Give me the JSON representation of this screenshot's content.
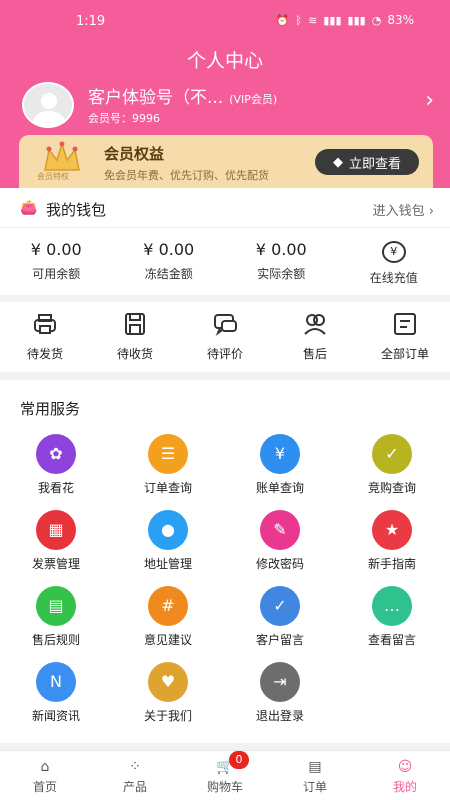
{
  "status_bar": {
    "time": "1:19",
    "icons": [
      "alarm-icon",
      "bluetooth-icon",
      "wifi-icon",
      "signal-icon",
      "signal-icon",
      "battery-icon"
    ],
    "battery": "83%"
  },
  "page_title": "个人中心",
  "profile": {
    "name": "客户体验号（不...",
    "vip_label": "(VIP会员)",
    "member_no": "会员号：9996"
  },
  "vip_card": {
    "badge_text": "会员特权",
    "title": "会员权益",
    "desc": "免会员年费、优先订购、优先配货",
    "button": "立即查看"
  },
  "wallet": {
    "title": "我的钱包",
    "link": "进入钱包",
    "items": [
      {
        "amount": "¥ 0.00",
        "label": "可用余额"
      },
      {
        "amount": "¥ 0.00",
        "label": "冻结金额"
      },
      {
        "amount": "¥ 0.00",
        "label": "实际余额"
      },
      {
        "icon": "¥",
        "label": "在线充值"
      }
    ]
  },
  "orders": [
    {
      "label": "待发货",
      "icon": "printer-icon"
    },
    {
      "label": "待收货",
      "icon": "save-icon"
    },
    {
      "label": "待评价",
      "icon": "chat-icon"
    },
    {
      "label": "售后",
      "icon": "people-icon"
    },
    {
      "label": "全部订单",
      "icon": "list-icon"
    }
  ],
  "services": {
    "title": "常用服务",
    "items": [
      {
        "label": "我看花",
        "color": "#8e44dc",
        "glyph": "✿"
      },
      {
        "label": "订单查询",
        "color": "#f3a01e",
        "glyph": "☰"
      },
      {
        "label": "账单查询",
        "color": "#2f8ff0",
        "glyph": "¥"
      },
      {
        "label": "竞购查询",
        "color": "#b7b321",
        "glyph": "✓"
      },
      {
        "label": "发票管理",
        "color": "#e8333b",
        "glyph": "▦"
      },
      {
        "label": "地址管理",
        "color": "#2aa0f5",
        "glyph": "●"
      },
      {
        "label": "修改密码",
        "color": "#e8388f",
        "glyph": "✎"
      },
      {
        "label": "新手指南",
        "color": "#ea3a43",
        "glyph": "★"
      },
      {
        "label": "售后规则",
        "color": "#35c24a",
        "glyph": "▤"
      },
      {
        "label": "意见建议",
        "color": "#f08a1f",
        "glyph": "#"
      },
      {
        "label": "客户留言",
        "color": "#3f87e0",
        "glyph": "✓"
      },
      {
        "label": "查看留言",
        "color": "#2fc28f",
        "glyph": "…"
      },
      {
        "label": "新闻资讯",
        "color": "#3b8ff0",
        "glyph": "N"
      },
      {
        "label": "关于我们",
        "color": "#dfa42f",
        "glyph": "♥"
      },
      {
        "label": "退出登录",
        "color": "#6d6d6d",
        "glyph": "⇥"
      }
    ]
  },
  "tabbar": [
    {
      "label": "首页",
      "glyph": "⌂"
    },
    {
      "label": "产品",
      "glyph": "⁘"
    },
    {
      "label": "购物车",
      "glyph": "🛒",
      "badge": "0"
    },
    {
      "label": "订单",
      "glyph": "▤"
    },
    {
      "label": "我的",
      "glyph": "☺",
      "active": true
    }
  ]
}
